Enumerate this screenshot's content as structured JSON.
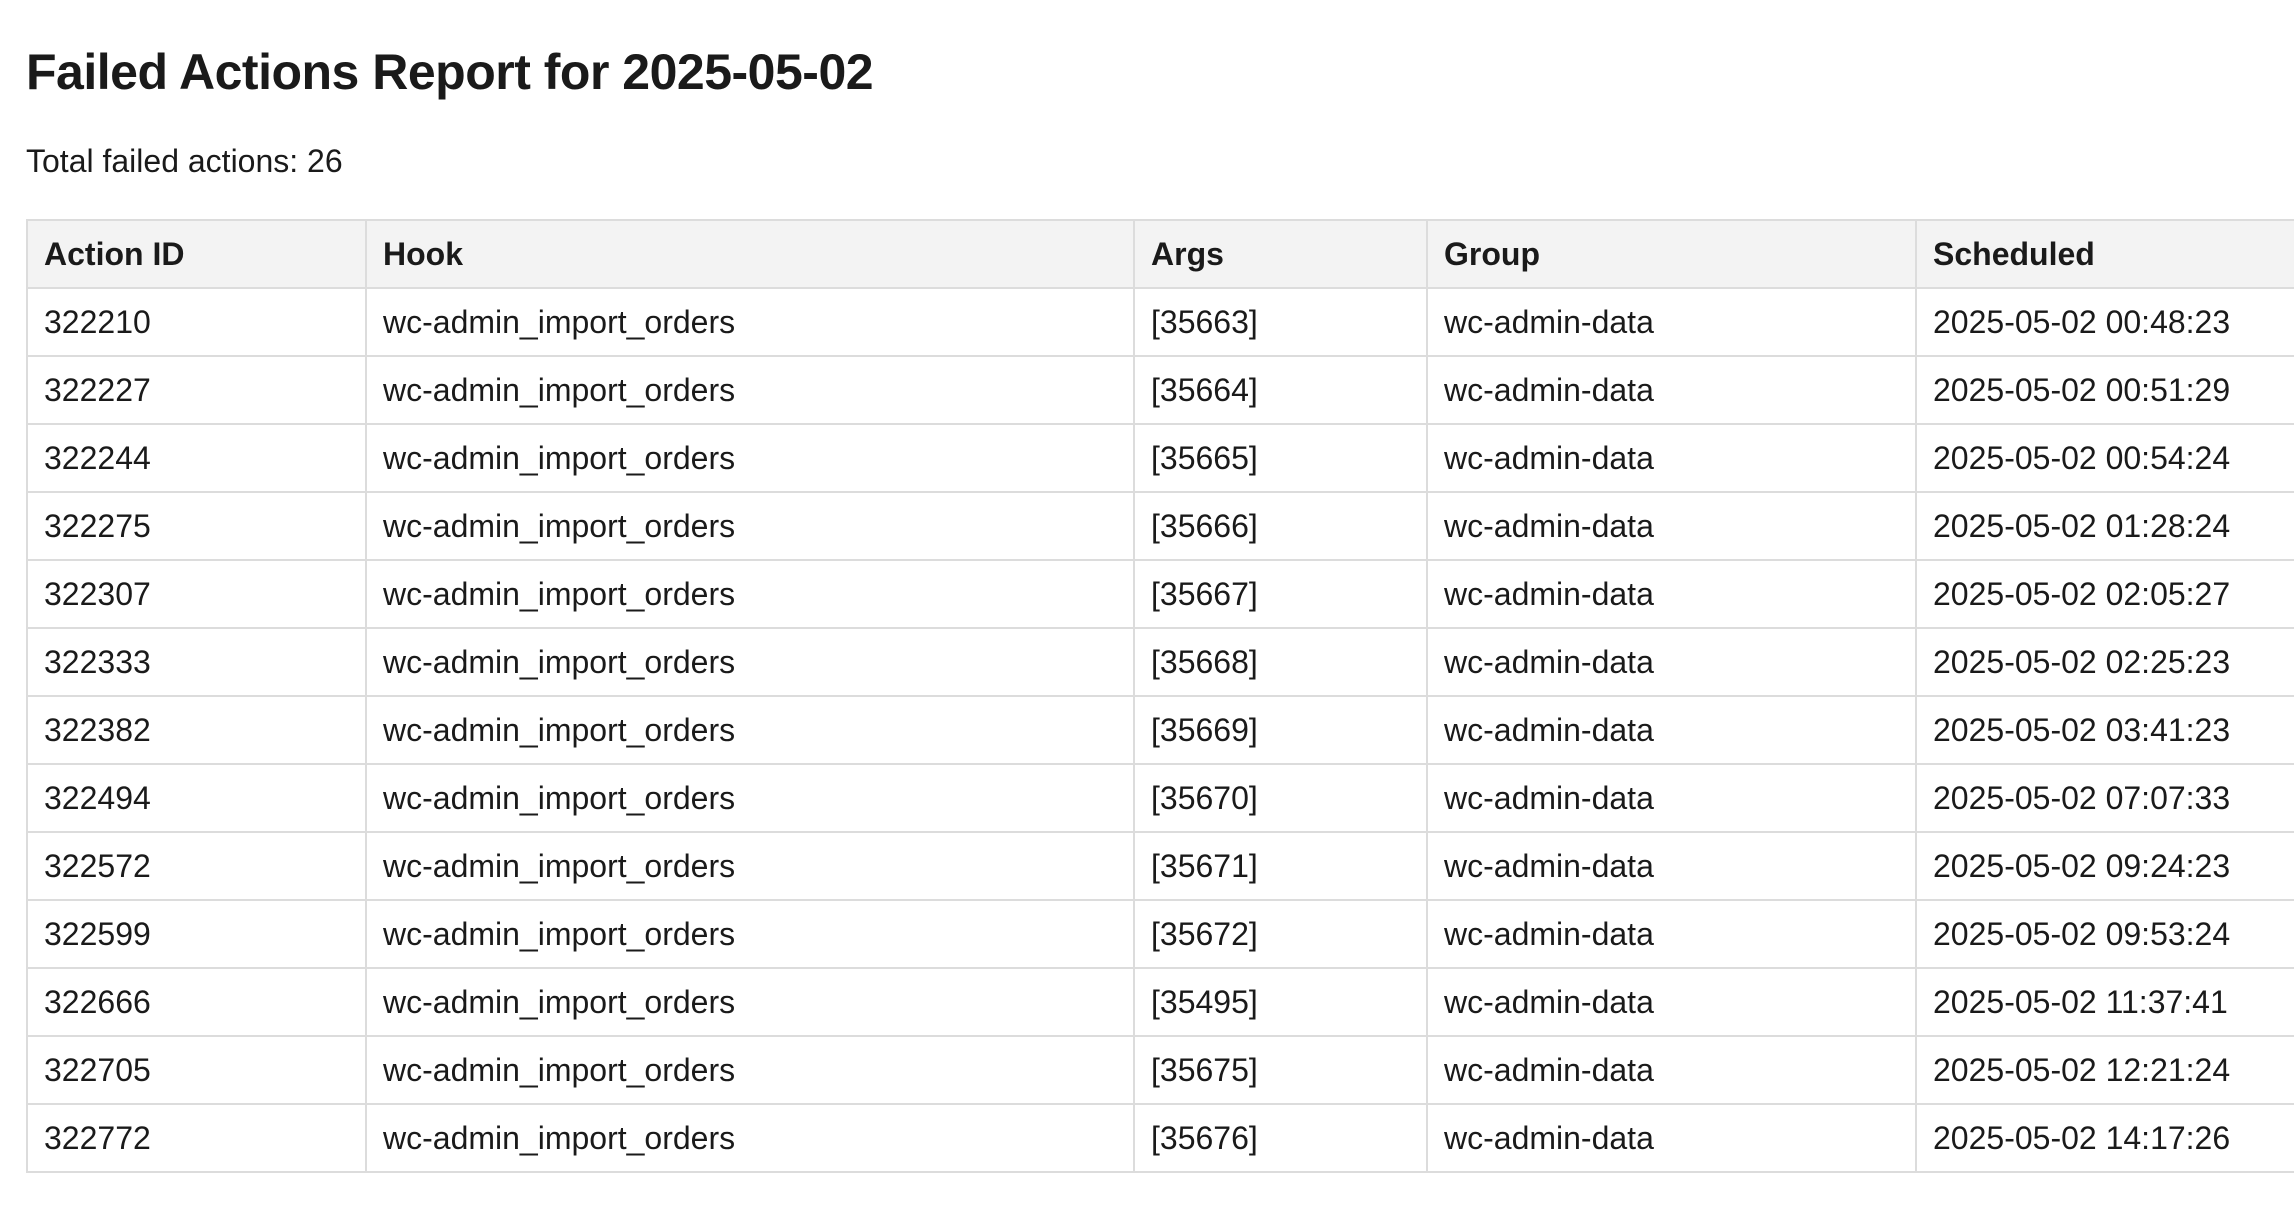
{
  "report": {
    "title": "Failed Actions Report for 2025-05-02",
    "total_label": "Total failed actions:",
    "total_count": "26"
  },
  "table": {
    "columns": [
      "Action ID",
      "Hook",
      "Args",
      "Group",
      "Scheduled"
    ],
    "rows": [
      [
        "322210",
        "wc-admin_import_orders",
        "[35663]",
        "wc-admin-data",
        "2025-05-02 00:48:23"
      ],
      [
        "322227",
        "wc-admin_import_orders",
        "[35664]",
        "wc-admin-data",
        "2025-05-02 00:51:29"
      ],
      [
        "322244",
        "wc-admin_import_orders",
        "[35665]",
        "wc-admin-data",
        "2025-05-02 00:54:24"
      ],
      [
        "322275",
        "wc-admin_import_orders",
        "[35666]",
        "wc-admin-data",
        "2025-05-02 01:28:24"
      ],
      [
        "322307",
        "wc-admin_import_orders",
        "[35667]",
        "wc-admin-data",
        "2025-05-02 02:05:27"
      ],
      [
        "322333",
        "wc-admin_import_orders",
        "[35668]",
        "wc-admin-data",
        "2025-05-02 02:25:23"
      ],
      [
        "322382",
        "wc-admin_import_orders",
        "[35669]",
        "wc-admin-data",
        "2025-05-02 03:41:23"
      ],
      [
        "322494",
        "wc-admin_import_orders",
        "[35670]",
        "wc-admin-data",
        "2025-05-02 07:07:33"
      ],
      [
        "322572",
        "wc-admin_import_orders",
        "[35671]",
        "wc-admin-data",
        "2025-05-02 09:24:23"
      ],
      [
        "322599",
        "wc-admin_import_orders",
        "[35672]",
        "wc-admin-data",
        "2025-05-02 09:53:24"
      ],
      [
        "322666",
        "wc-admin_import_orders",
        "[35495]",
        "wc-admin-data",
        "2025-05-02 11:37:41"
      ],
      [
        "322705",
        "wc-admin_import_orders",
        "[35675]",
        "wc-admin-data",
        "2025-05-02 12:21:24"
      ],
      [
        "322772",
        "wc-admin_import_orders",
        "[35676]",
        "wc-admin-data",
        "2025-05-02 14:17:26"
      ]
    ]
  }
}
